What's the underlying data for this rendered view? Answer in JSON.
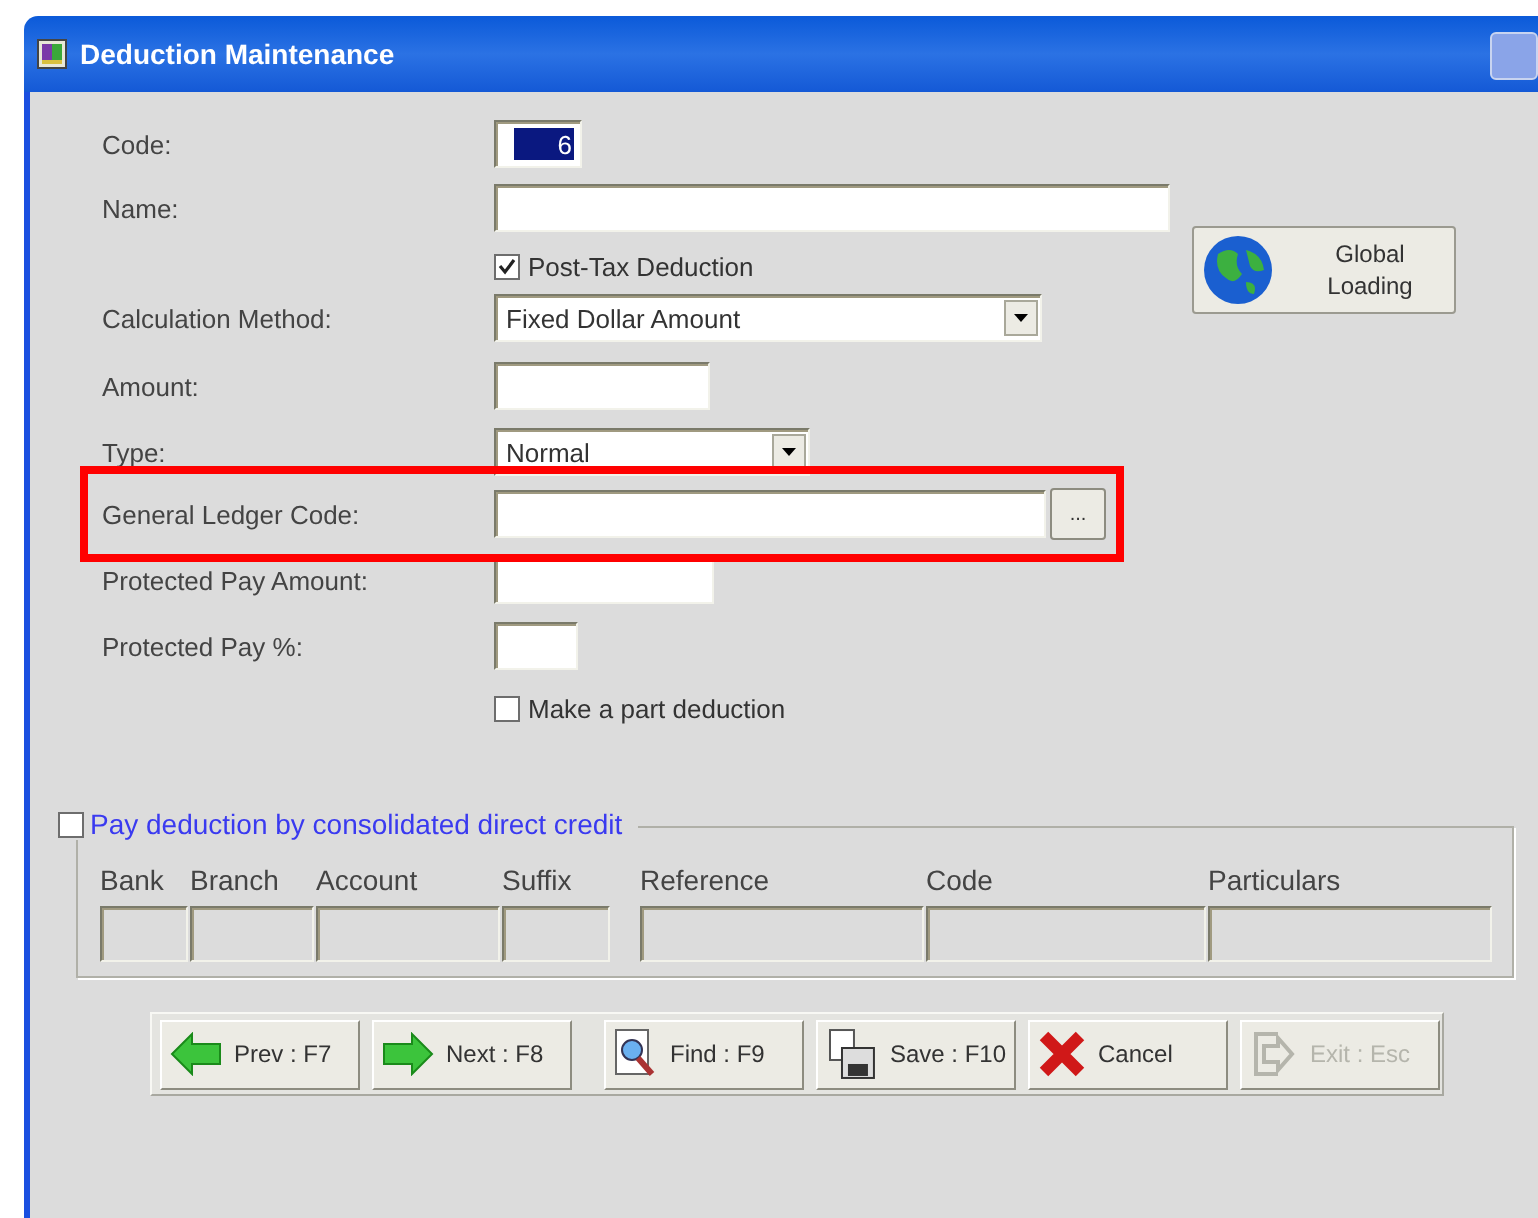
{
  "window": {
    "title": "Deduction Maintenance"
  },
  "fields": [
    {
      "kind": "text",
      "label": "Code:",
      "value": "6",
      "selected": true
    },
    {
      "kind": "text",
      "label": "Name:"
    },
    {
      "kind": "checkbox",
      "label": "Post-Tax Deduction",
      "checked": true
    },
    {
      "kind": "combo",
      "label": "Calculation Method:",
      "value": "Fixed Dollar Amount"
    },
    {
      "kind": "text",
      "label": "Amount:"
    },
    {
      "kind": "combo",
      "label": "Type:",
      "value": "Normal"
    },
    {
      "kind": "lookup",
      "label": "General Ledger Code:",
      "button": "..."
    },
    {
      "kind": "text",
      "label": "Protected Pay Amount:"
    },
    {
      "kind": "text",
      "label": "Protected Pay %:"
    },
    {
      "kind": "checkbox",
      "label": "Make a part deduction",
      "checked": false
    }
  ],
  "global_loading": {
    "label": "Global Loading"
  },
  "direct_credit": {
    "label": "Pay deduction by consolidated direct credit",
    "checked": false,
    "columns": [
      "Bank",
      "Branch",
      "Account",
      "Suffix",
      "Reference",
      "Code",
      "Particulars"
    ]
  },
  "buttons": [
    {
      "kind": "prev",
      "label": "Prev : F7",
      "disabled": false
    },
    {
      "kind": "next",
      "label": "Next : F8",
      "disabled": false
    },
    {
      "kind": "find",
      "label": "Find : F9",
      "disabled": false
    },
    {
      "kind": "save",
      "label": "Save : F10",
      "disabled": false
    },
    {
      "kind": "cancel",
      "label": "Cancel",
      "disabled": false
    },
    {
      "kind": "exit",
      "label": "Exit : Esc",
      "disabled": true
    }
  ]
}
